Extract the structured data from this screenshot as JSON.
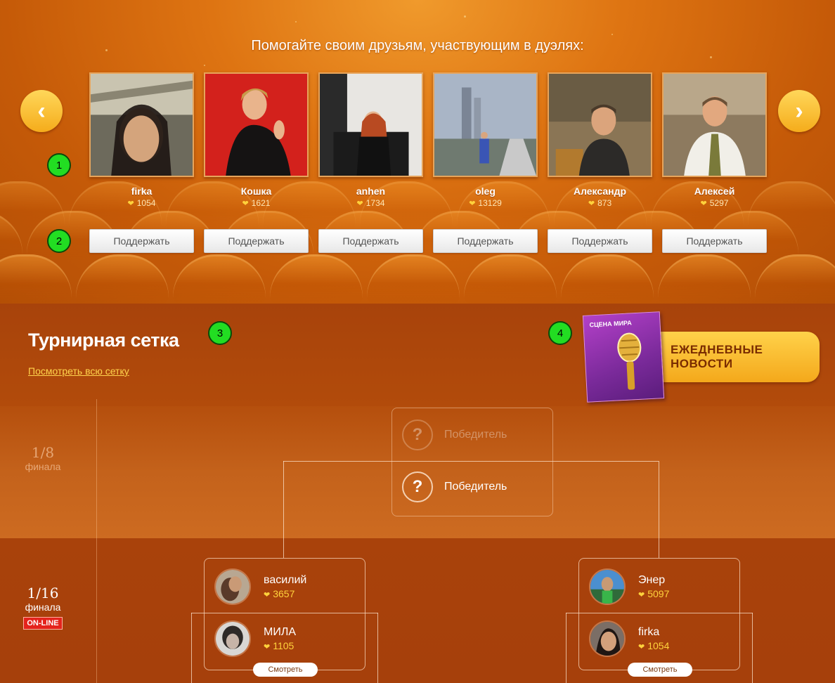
{
  "carousel": {
    "headline": "Помогайте своим друзьям, участвующим в дуэлях:",
    "prev_icon": "‹",
    "next_icon": "›",
    "friends": [
      {
        "name": "firka",
        "score": "1054",
        "support": "Поддержать"
      },
      {
        "name": "Кошка",
        "score": "1621",
        "support": "Поддержать"
      },
      {
        "name": "anhen",
        "score": "1734",
        "support": "Поддержать"
      },
      {
        "name": "oleg",
        "score": "13129",
        "support": "Поддержать"
      },
      {
        "name": "Александр",
        "score": "873",
        "support": "Поддержать"
      },
      {
        "name": "Алексей",
        "score": "5297",
        "support": "Поддержать"
      }
    ]
  },
  "markers": [
    "1",
    "2",
    "3",
    "4"
  ],
  "tournament": {
    "title": "Турнирная сетка",
    "view_all": "Посмотреть всю сетку",
    "stages": [
      {
        "frac": "1/8",
        "word": "финала"
      },
      {
        "frac": "1/16",
        "word": "финала",
        "badge": "ON-LINE"
      }
    ],
    "winner_slots": [
      "Победитель",
      "Победитель"
    ],
    "winner_icon": "?",
    "matches": [
      {
        "players": [
          {
            "name": "василий",
            "score": "3657"
          },
          {
            "name": "МИЛА",
            "score": "1105"
          }
        ],
        "watch": "Смотреть"
      },
      {
        "players": [
          {
            "name": "Энер",
            "score": "5097"
          },
          {
            "name": "firka",
            "score": "1054"
          }
        ],
        "watch": "Смотреть"
      }
    ]
  },
  "news": {
    "label_line1": "ЕЖЕДНЕВНЫЕ",
    "label_line2": "НОВОСТИ",
    "magazine_title": "СЦЕНА МИРА"
  },
  "colors": {
    "accent_yellow": "#ffd23c",
    "online_red": "#e4231c",
    "marker_green": "#22dd22"
  }
}
